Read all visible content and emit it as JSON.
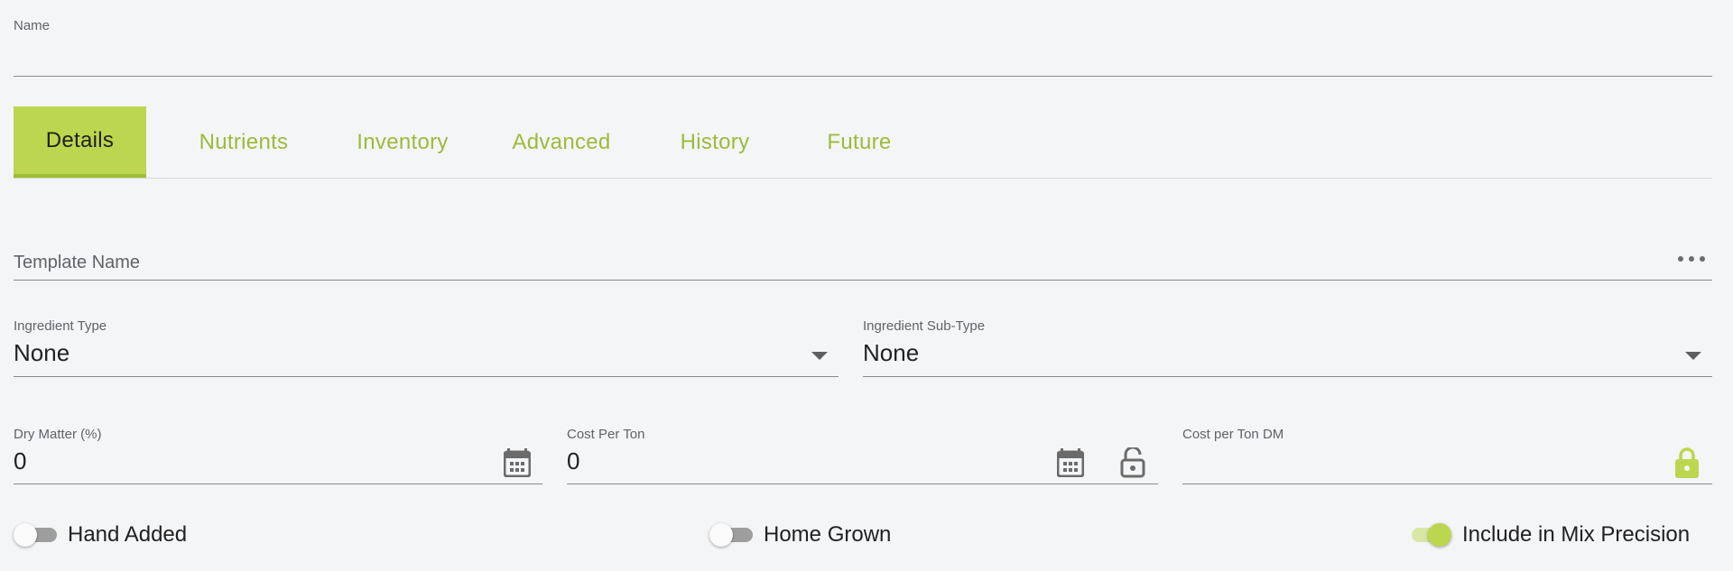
{
  "name_field": {
    "label": "Name",
    "value": ""
  },
  "tabs": [
    {
      "label": "Details",
      "active": true
    },
    {
      "label": "Nutrients",
      "active": false
    },
    {
      "label": "Inventory",
      "active": false
    },
    {
      "label": "Advanced",
      "active": false
    },
    {
      "label": "History",
      "active": false
    },
    {
      "label": "Future",
      "active": false
    }
  ],
  "template_field": {
    "placeholder": "Template Name"
  },
  "ingredient_type": {
    "label": "Ingredient Type",
    "value": "None"
  },
  "ingredient_sub_type": {
    "label": "Ingredient Sub-Type",
    "value": "None"
  },
  "dry_matter": {
    "label": "Dry Matter (%)",
    "value": "0"
  },
  "cost_per_ton": {
    "label": "Cost Per Ton",
    "value": "0"
  },
  "cost_per_ton_dm": {
    "label": "Cost per Ton DM",
    "value": ""
  },
  "toggles": [
    {
      "label": "Hand Added",
      "on": false
    },
    {
      "label": "Home Grown",
      "on": false
    },
    {
      "label": "Include in Mix Precision",
      "on": true
    }
  ],
  "colors": {
    "accent": "#bcd64f",
    "accent_text": "#9bbb3a",
    "background": "#f4f5f7",
    "icon_gray": "#6b6b6b"
  },
  "icons": [
    "more-horiz-icon",
    "dropdown-caret-icon",
    "calendar-icon",
    "lock-open-icon",
    "lock-icon"
  ]
}
